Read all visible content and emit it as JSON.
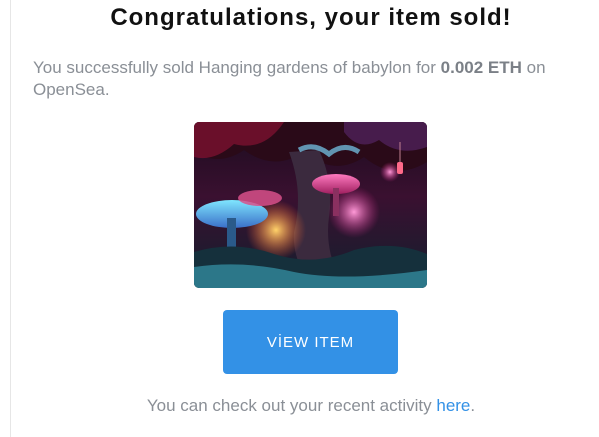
{
  "email": {
    "title": "Congratulations, your item sold!",
    "message": {
      "prefix": "You successfully sold Hanging gardens of babylon for ",
      "price": "0.002 ETH",
      "suffix": " on OpenSea."
    },
    "artwork": {
      "icon": "nft-artwork-image"
    },
    "button_label": "VİEW ITEM",
    "footer": {
      "text": "You can check out your recent activity ",
      "link_label": "here",
      "end": "."
    }
  },
  "colors": {
    "accent": "#3391e6",
    "muted_text": "#8a8f96",
    "title_text": "#111111"
  }
}
